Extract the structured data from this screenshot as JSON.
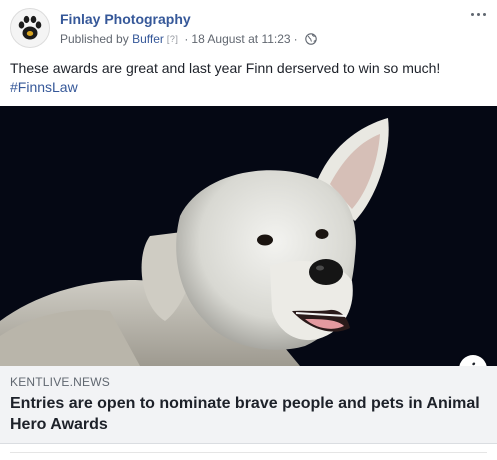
{
  "post": {
    "author": "Finlay Photography",
    "published_by_prefix": "Published by",
    "published_by": "Buffer",
    "published_by_help": "[?]",
    "separator": "·",
    "timestamp": "18 August at 11:23",
    "privacy_icon": "globe-icon",
    "more_icon": "more-options-icon",
    "text": "These awards are great and last year Finn derserved to win so much!",
    "hashtag": "#FinnsLaw"
  },
  "image": {
    "subject": "white dog",
    "info_label": "i",
    "info_icon": "info-icon"
  },
  "link_preview": {
    "domain": "KENTLIVE.NEWS",
    "title": "Entries are open to nominate brave people and pets in Animal Hero Awards"
  },
  "colors": {
    "link_blue": "#365899",
    "meta_gray": "#616770",
    "preview_bg": "#f2f3f5",
    "photo_bg": "#050814"
  }
}
